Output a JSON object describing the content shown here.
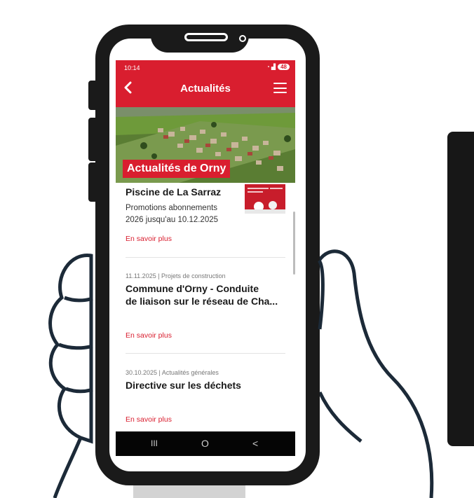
{
  "status_bar": {
    "time": "10:14",
    "battery": "48"
  },
  "app_bar": {
    "title": "Actualités"
  },
  "hero": {
    "label": "Actualités de Orny"
  },
  "articles": [
    {
      "meta": "",
      "title": "Piscine de La Sarraz",
      "description_line1": "Promotions abonnements",
      "description_line2": "2026 jusqu'au 10.12.2025",
      "more": "En savoir plus"
    },
    {
      "meta": "11.11.2025 | Projets de construction",
      "title_line1": "Commune d'Orny - Conduite",
      "title_line2": "de liaison sur le réseau de Cha...",
      "more": "En savoir plus"
    },
    {
      "meta": "30.10.2025 | Actualités générales",
      "title": "Directive sur les déchets",
      "more": "En savoir plus"
    }
  ],
  "nav_bar": {
    "recent": "III",
    "home": "O",
    "back": "<"
  },
  "colors": {
    "accent": "#d91e2f",
    "phone_body": "#1a1a1a",
    "hand_outline": "#1c2a38"
  }
}
